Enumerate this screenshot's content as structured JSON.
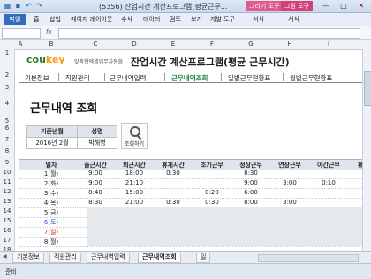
{
  "window": {
    "title": "(5356) 잔업시간 계산프로그램(평균근무...",
    "context_tabs": [
      "그리기 도구",
      "그림 도구"
    ],
    "controls": [
      "—",
      "□",
      "✕"
    ]
  },
  "ribbon": {
    "file": "파일",
    "tabs": [
      "홈",
      "삽입",
      "페이지 레이아웃",
      "수식",
      "데이터",
      "검토",
      "보기",
      "개발 도구",
      "서식",
      "서식"
    ]
  },
  "formula_bar": {
    "name_box": "",
    "fx": "fx"
  },
  "columns": [
    "A",
    "B",
    "C",
    "D",
    "E",
    "F",
    "G",
    "H",
    "I"
  ],
  "rows": [
    "1",
    "2",
    "3",
    "4",
    "5",
    "6",
    "7",
    "8",
    "9",
    "10",
    "11",
    "12",
    "13",
    "14",
    "15",
    "16",
    "17",
    "18"
  ],
  "sheet": {
    "logo_main": "cou",
    "logo_accent": "key",
    "tagline": "맞춤형엑셀업무자동화",
    "app_title": "잔업시간 계산프로그램(평균 근무시간)",
    "menu": [
      "기본정보",
      "직원관리",
      "근무내역입력",
      "근무내역조회",
      "일별근무현황표",
      "월별근무현황표"
    ],
    "active_menu": "근무내역조회",
    "page_title": "근무내역 조회",
    "filter": {
      "period_label": "기준년월",
      "name_label": "성명",
      "period_value": "2016년 2월",
      "name_value": "박해영",
      "search_label": "조회하기"
    }
  },
  "table": {
    "headers": [
      "일자",
      "출근시간",
      "퇴근시간",
      "휴게시간",
      "조기근무",
      "정상근무",
      "연장근무",
      "야간근무",
      "휴"
    ],
    "rows": [
      {
        "date": "1(월)",
        "in": "9:00",
        "out": "18:00",
        "rest": "0:30",
        "early": "",
        "normal": "8:30",
        "overtime": "",
        "night": "",
        "shaded": false,
        "color": "#222"
      },
      {
        "date": "2(화)",
        "in": "9:00",
        "out": "21:10",
        "rest": "",
        "early": "",
        "normal": "9:00",
        "overtime": "3:00",
        "night": "0:10",
        "shaded": false,
        "color": "#222"
      },
      {
        "date": "3(수)",
        "in": "8:40",
        "out": "15:00",
        "rest": "",
        "early": "0:20",
        "normal": "6:00",
        "overtime": "",
        "night": "",
        "shaded": false,
        "color": "#222"
      },
      {
        "date": "4(목)",
        "in": "8:30",
        "out": "21:00",
        "rest": "0:30",
        "early": "0:30",
        "normal": "8:00",
        "overtime": "3:00",
        "night": "",
        "shaded": false,
        "color": "#222"
      },
      {
        "date": "5(금)",
        "in": "",
        "out": "",
        "rest": "",
        "early": "",
        "normal": "",
        "overtime": "",
        "night": "",
        "shaded": true,
        "color": "#222"
      },
      {
        "date": "6(토)",
        "in": "",
        "out": "",
        "rest": "",
        "early": "",
        "normal": "",
        "overtime": "",
        "night": "",
        "shaded": true,
        "color": "#1f4fd1"
      },
      {
        "date": "7(일)",
        "in": "",
        "out": "",
        "rest": "",
        "early": "",
        "normal": "",
        "overtime": "",
        "night": "",
        "shaded": true,
        "color": "#d41c1c"
      },
      {
        "date": "8(월)",
        "in": "",
        "out": "",
        "rest": "",
        "early": "",
        "normal": "",
        "overtime": "",
        "night": "",
        "shaded": true,
        "color": "#222"
      }
    ]
  },
  "sheet_tabs": [
    "기본정보",
    "직원관리",
    "근무내역입력",
    "근무내역조회",
    "일"
  ],
  "active_sheet": "근무내역조회",
  "status": "준비"
}
